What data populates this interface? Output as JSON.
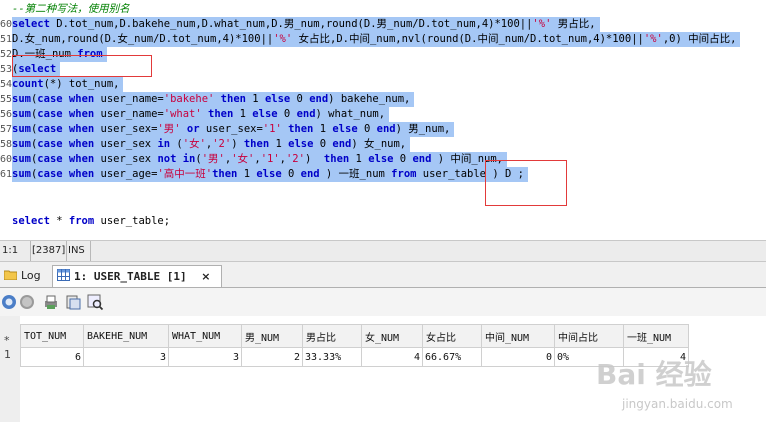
{
  "editor": {
    "lines": [
      {
        "no": "",
        "cls": "",
        "html": "<span class=\"cm\">--第二种写法，使用别名</span>"
      },
      {
        "no": "60",
        "cls": "sel",
        "html": "<span class=\"kw\">select</span> D.tot_num,D.bakehe_num,D.what_num,D.男_num,round(D.男_num/D.tot_num,4)*100||<span class=\"str\">'%'</span> 男占比,"
      },
      {
        "no": "51",
        "cls": "sel",
        "html": "D.女_num,round(D.女_num/D.tot_num,4)*100||<span class=\"str\">'%'</span> 女占比,D.中间_num,nvl(round(D.中间_num/D.tot_num,4)*100||<span class=\"str\">'%'</span>,0) 中间占比,"
      },
      {
        "no": "52",
        "cls": "sel",
        "html": "D.一班_num <span class=\"kw\">from</span>"
      },
      {
        "no": "53",
        "cls": "sel",
        "html": "(<span class=\"kw\">select</span>"
      },
      {
        "no": "54",
        "cls": "sel",
        "html": "<span class=\"kw\">count</span>(*) tot_num,"
      },
      {
        "no": "55",
        "cls": "sel",
        "html": "<span class=\"kw\">sum</span>(<span class=\"kw\">case</span> <span class=\"kw\">when</span> user_name=<span class=\"str\">'bakehe'</span> <span class=\"kw\">then</span> 1 <span class=\"kw\">else</span> 0 <span class=\"kw\">end</span>) bakehe_num,"
      },
      {
        "no": "56",
        "cls": "sel",
        "html": "<span class=\"kw\">sum</span>(<span class=\"kw\">case</span> <span class=\"kw\">when</span> user_name=<span class=\"str\">'what'</span> <span class=\"kw\">then</span> 1 <span class=\"kw\">else</span> 0 <span class=\"kw\">end</span>) what_num,"
      },
      {
        "no": "57",
        "cls": "sel",
        "html": "<span class=\"kw\">sum</span>(<span class=\"kw\">case</span> <span class=\"kw\">when</span> user_sex=<span class=\"str\">'男'</span> <span class=\"kw\">or</span> user_sex=<span class=\"str\">'1'</span> <span class=\"kw\">then</span> 1 <span class=\"kw\">else</span> 0 <span class=\"kw\">end</span>) 男_num,"
      },
      {
        "no": "58",
        "cls": "sel",
        "html": "<span class=\"kw\">sum</span>(<span class=\"kw\">case</span> <span class=\"kw\">when</span> user_sex <span class=\"kw\">in</span> (<span class=\"str\">'女'</span>,<span class=\"str\">'2'</span>) <span class=\"kw\">then</span> 1 <span class=\"kw\">else</span> 0 <span class=\"kw\">end</span>) 女_num,"
      },
      {
        "no": "60",
        "cls": "sel",
        "html": "<span class=\"kw\">sum</span>(<span class=\"kw\">case</span> <span class=\"kw\">when</span> user_sex <span class=\"kw\">not</span> <span class=\"kw\">in</span>(<span class=\"str\">'男'</span>,<span class=\"str\">'女'</span>,<span class=\"str\">'1'</span>,<span class=\"str\">'2'</span>)  <span class=\"kw\">then</span> 1 <span class=\"kw\">else</span> 0 <span class=\"kw\">end</span> ) 中间_num,"
      },
      {
        "no": "61",
        "cls": "sel",
        "html": "<span class=\"kw\">sum</span>(<span class=\"kw\">case</span> <span class=\"kw\">when</span> user_age=<span class=\"str\">'高中一班'</span><span class=\"kw\">then</span> 1 <span class=\"kw\">else</span> 0 <span class=\"kw\">end</span> ) 一班_num <span class=\"kw\">from</span> user_table ) D ;"
      },
      {
        "no": "",
        "cls": "",
        "html": ""
      },
      {
        "no": "",
        "cls": "",
        "html": ""
      },
      {
        "no": "",
        "cls": "",
        "html": "<span class=\"kw\">select</span> * <span class=\"kw\">from</span> user_table;"
      }
    ]
  },
  "statusbar": {
    "position": "1:1",
    "count": "[2387]",
    "mode": "INS"
  },
  "tabs": {
    "log_label": "Log",
    "result_label": "1: USER_TABLE [1]",
    "close_glyph": "×"
  },
  "grid": {
    "row_marker": "*",
    "columns": [
      "TOT_NUM",
      "BAKEHE_NUM",
      "WHAT_NUM",
      "男_NUM",
      "男占比",
      "女_NUM",
      "女占比",
      "中间_NUM",
      "中间占比",
      "一班_NUM"
    ],
    "rows": [
      {
        "rownum": "1",
        "cells": [
          "6",
          "3",
          "3",
          "2",
          "33.33%",
          "4",
          "66.67%",
          "0",
          "0%",
          "4"
        ]
      }
    ]
  },
  "watermark": {
    "line1": "Bai 经验",
    "line2": "jingyan.baidu.com"
  },
  "colors": {
    "selection": "#a5c7f5",
    "keyword": "#0000c8",
    "string": "#c8003c",
    "comment": "#008000",
    "annotation_box": "#e23a3a"
  }
}
